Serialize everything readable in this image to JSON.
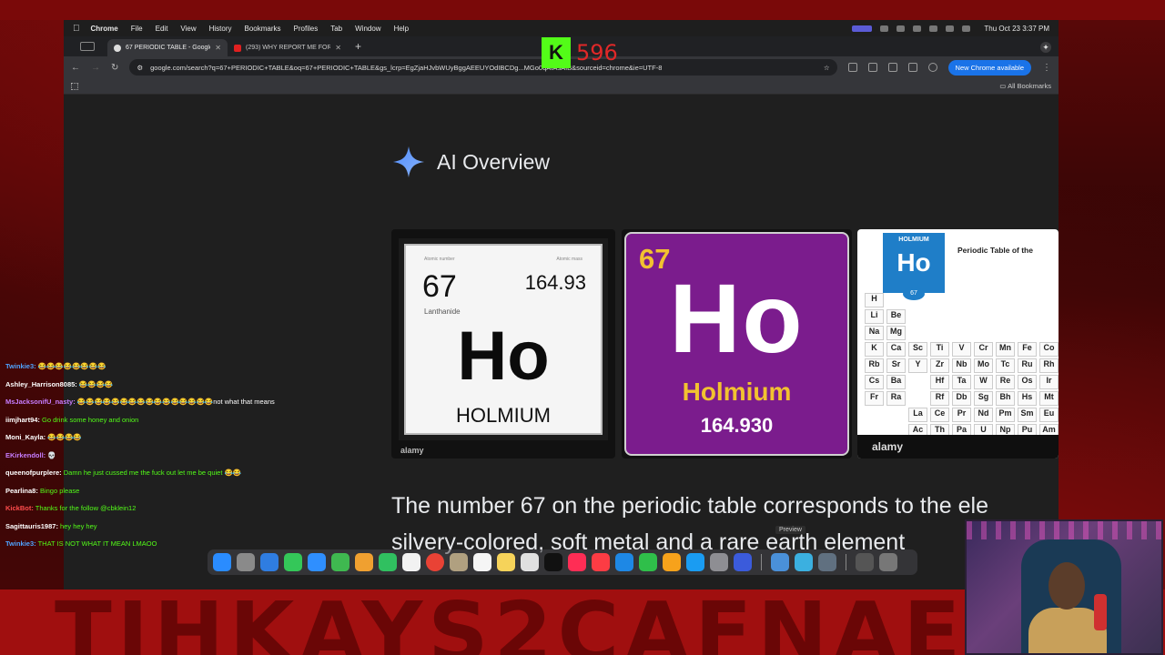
{
  "menubar": {
    "app": "Chrome",
    "items": [
      "File",
      "Edit",
      "View",
      "History",
      "Bookmarks",
      "Profiles",
      "Tab",
      "Window",
      "Help"
    ],
    "clock": "Thu Oct 23  3:37 PM"
  },
  "tabs": [
    {
      "title": "67 PERIODIC TABLE - Google",
      "active": true
    },
    {
      "title": "(293) WHY REPORT ME FOR",
      "active": false
    }
  ],
  "address": {
    "url": "google.com/search?q=67+PERIODIC+TABLE&oq=67+PERIODIC+TABLE&gs_lcrp=EgZjaHJvbWUyBggAEEUYOdIBCDg...MGo0qAIAsAIB&sourceid=chrome&ie=UTF-8",
    "update_label": "New Chrome available"
  },
  "bookmarks": {
    "all_label": "All Bookmarks"
  },
  "kick": {
    "viewer_count": "596"
  },
  "ai_overview": {
    "title": "AI Overview",
    "answer_line1": "The number 67 on the periodic table corresponds to the ele",
    "answer_line2": "silvery-colored, soft metal and a rare earth element"
  },
  "cards": {
    "card1": {
      "number": "67",
      "mass": "164.93",
      "series": "Lanthanide",
      "symbol": "Ho",
      "name": "HOLMIUM",
      "label_number": "Atomic number",
      "label_mass": "Atomic mass",
      "watermark": "alamy"
    },
    "card2": {
      "number": "67",
      "symbol": "Ho",
      "name": "Holmium",
      "mass": "164.930"
    },
    "card3": {
      "highlight_name": "HOLMIUM",
      "highlight_symbol": "Ho",
      "highlight_number": "67",
      "title": "Periodic Table of the",
      "watermark": "alamy",
      "cells": [
        "H",
        "",
        "",
        "",
        "",
        "",
        "",
        "",
        "",
        "Li",
        "Be",
        "",
        "",
        "",
        "",
        "",
        "",
        "",
        "Na",
        "Mg",
        "",
        "",
        "",
        "",
        "",
        "",
        "",
        "K",
        "Ca",
        "Sc",
        "Ti",
        "V",
        "Cr",
        "Mn",
        "Fe",
        "Co",
        "Rb",
        "Sr",
        "Y",
        "Zr",
        "Nb",
        "Mo",
        "Tc",
        "Ru",
        "Rh",
        "Cs",
        "Ba",
        "",
        "Hf",
        "Ta",
        "W",
        "Re",
        "Os",
        "Ir",
        "Fr",
        "Ra",
        "",
        "Rf",
        "Db",
        "Sg",
        "Bh",
        "Hs",
        "Mt",
        "",
        "",
        "La",
        "Ce",
        "Pr",
        "Nd",
        "Pm",
        "Sm",
        "Eu",
        "",
        "",
        "Ac",
        "Th",
        "Pa",
        "U",
        "Np",
        "Pu",
        "Am"
      ]
    }
  },
  "preview_tooltip": "Preview",
  "chat": [
    {
      "user": "Twinkie3:",
      "text": "😂😂😂😂😂😂😂😂",
      "color": "#4fa3ff"
    },
    {
      "user": "Ashley_Harrison8085:",
      "text": "😂😂😂😂",
      "color": "#ffffff"
    },
    {
      "user": "MsJacksonifU_nasty:",
      "text": "😂😂😂😂😂😂😂😂😂😂😂😂😂😂😂😂not what that means",
      "color": "#c77dff"
    },
    {
      "user": "iimjhart94:",
      "text": "Go drink some honey and onion",
      "color": "#ffffff"
    },
    {
      "user": "Moni_Kayla:",
      "text": "😂😂😂😂",
      "color": "#ffffff"
    },
    {
      "user": "EKirkendoll:",
      "text": "💀",
      "color": "#c77dff"
    },
    {
      "user": "queenofpurplere:",
      "text": "Damn he just cussed me the fuck out let me be quiet 😂😂",
      "color": "#ffffff"
    },
    {
      "user": "Pearlina8:",
      "text": "Bingo please",
      "color": "#ffffff"
    },
    {
      "user": "KickBot:",
      "text": "Thanks for the follow @cbklein12",
      "color": "#ff4d4d"
    },
    {
      "user": "Sagittauris1987:",
      "text": "hey hey hey",
      "color": "#ffffff"
    },
    {
      "user": "Twinkie3:",
      "text": "THAT IS NOT WHAT IT MEAN LMAOO",
      "color": "#4fa3ff"
    }
  ],
  "banner_text": "TIHKAYS2CAFNAE",
  "colors": {
    "kick_green": "#53fc18",
    "holmium_purple": "#7b1c8d",
    "chrome_blue": "#1a73e8"
  }
}
